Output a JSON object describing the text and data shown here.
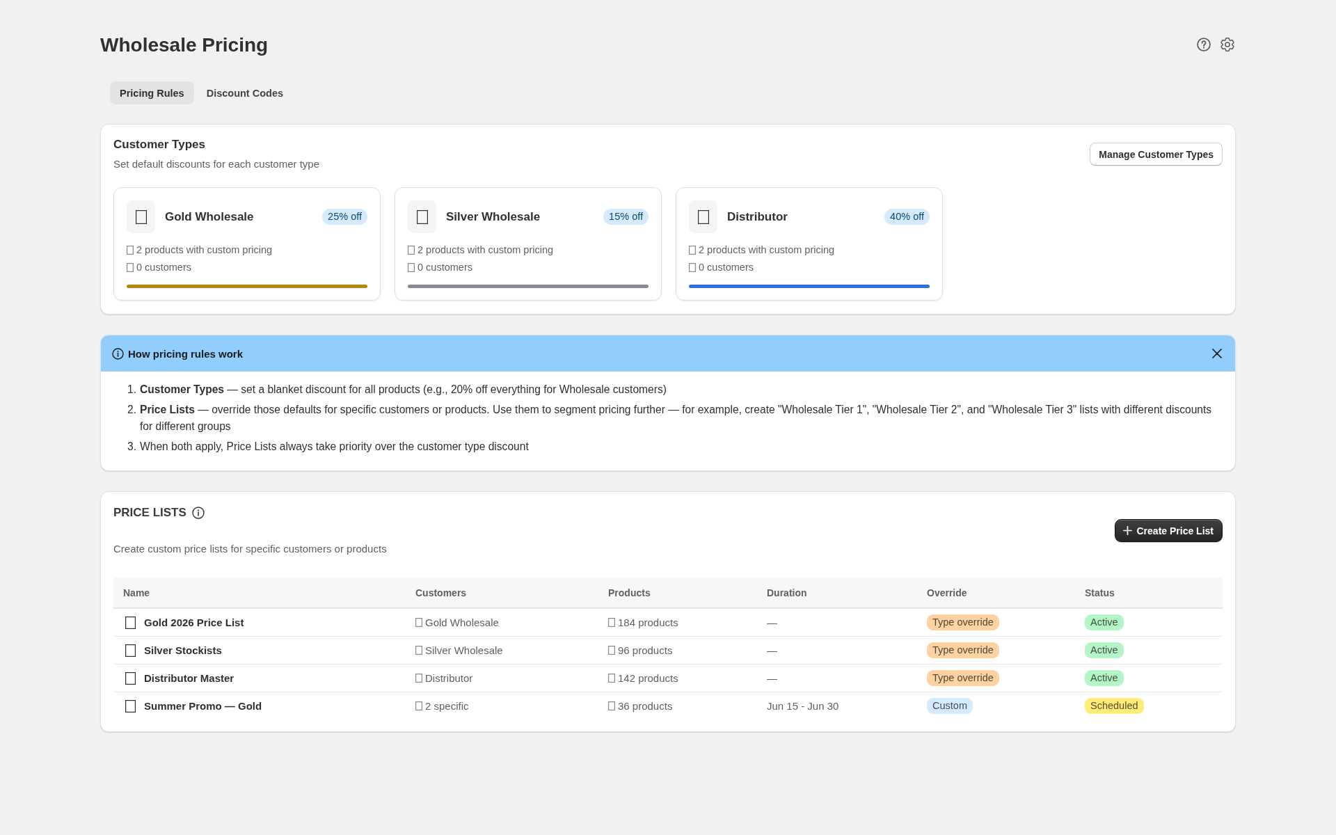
{
  "header": {
    "title": "Wholesale Pricing"
  },
  "tabs": [
    {
      "label": "Pricing Rules",
      "selected": true
    },
    {
      "label": "Discount Codes",
      "selected": false
    }
  ],
  "customer_types": {
    "title": "Customer Types",
    "subtitle": "Set default discounts for each customer type",
    "button": "Manage Customer Types",
    "cards": [
      {
        "name": "Gold Wholesale",
        "discount": "25% off",
        "products": "2 products with custom pricing",
        "customers": "0 customers",
        "color": "#b8860b"
      },
      {
        "name": "Silver Wholesale",
        "discount": "15% off",
        "products": "2 products with custom pricing",
        "customers": "0 customers",
        "color": "#8a8a96"
      },
      {
        "name": "Distributor",
        "discount": "40% off",
        "products": "2 products with custom pricing",
        "customers": "0 customers",
        "color": "#2f6fdf"
      }
    ]
  },
  "info_banner": {
    "title": "How pricing rules work",
    "items": [
      {
        "number": "1.",
        "text": "**Customer Types** — set a blanket discount for all products (e.g., 20% off everything for Wholesale customers)"
      },
      {
        "number": "2.",
        "text": "**Price Lists** — override those defaults for specific customers or products. Use them to segment pricing further — for example, create \"Wholesale Tier 1\", \"Wholesale Tier 2\", and \"Wholesale Tier 3\" lists with different discounts for different groups"
      },
      {
        "number": "3.",
        "text": "When both apply, Price Lists always take priority over the customer type discount"
      }
    ]
  },
  "price_lists": {
    "title": "PRICE LISTS",
    "subtitle": "Create custom price lists for specific customers or products",
    "button": "Create Price List",
    "table": {
      "columns": [
        "Name",
        "Customers",
        "Products",
        "Duration",
        "Override",
        "Status"
      ],
      "rows": [
        {
          "name": "Gold 2026 Price List",
          "customers": "Gold Wholesale",
          "products": "184 products",
          "duration": "—",
          "override": {
            "label": "Type override",
            "color": "#fed3a1"
          },
          "status": {
            "label": "Active",
            "color": "#b4f4c6"
          }
        },
        {
          "name": "Silver Stockists",
          "customers": "Silver Wholesale",
          "products": "96 products",
          "duration": "—",
          "override": {
            "label": "Type override",
            "color": "#fed3a1"
          },
          "status": {
            "label": "Active",
            "color": "#b4f4c6"
          }
        },
        {
          "name": "Distributor Master",
          "customers": "Distributor",
          "products": "142 products",
          "duration": "—",
          "override": {
            "label": "Type override",
            "color": "#fed3a1"
          },
          "status": {
            "label": "Active",
            "color": "#b4f4c6"
          }
        },
        {
          "name": "Summer Promo — Gold",
          "customers": "2 specific",
          "products": "36 products",
          "duration": "Jun 15 - Jun 30",
          "override": {
            "label": "Custom",
            "color": "#d5ebfd"
          },
          "status": {
            "label": "Scheduled",
            "color": "#ffeb78"
          }
        }
      ]
    }
  }
}
